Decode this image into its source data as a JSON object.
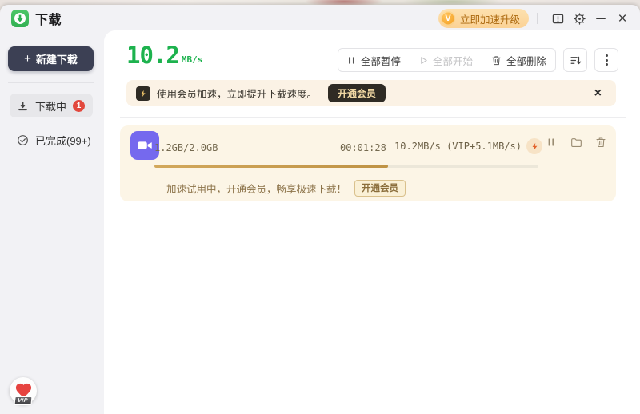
{
  "titlebar": {
    "app_title": "下载",
    "upgrade_button": {
      "badge_letter": "V",
      "label": "立即加速升级"
    }
  },
  "icons": {
    "plus": "+",
    "close": "×"
  },
  "sidebar": {
    "new_download_label": "新建下载",
    "items": [
      {
        "label": "下载中",
        "badge": "1"
      },
      {
        "label": "已完成(99+)"
      }
    ],
    "vip_tag": "VIP"
  },
  "header": {
    "speed_value": "10.2",
    "speed_unit": "MB/s",
    "toolbar": {
      "pause_all": "全部暂停",
      "start_all": "全部开始",
      "delete_all": "全部删除"
    }
  },
  "banner": {
    "message": "使用会员加速，立即提升下载速度。",
    "cta": "开通会员"
  },
  "task": {
    "size": "1.2GB/2.0GB",
    "time": "00:01:28",
    "speed": "10.2MB/s (VIP+5.1MB/s)",
    "progress_percent": 60.8,
    "trial_message": "加速试用中，开通会员，畅享极速下载！",
    "trial_cta": "开通会员"
  },
  "colors": {
    "window-bg": "#f2f2f5",
    "speed-green": "#1db24e",
    "gold": "#bf9345",
    "banner-bg": "#fbf2e5",
    "card-bg": "#fcf5e6",
    "badge-red": "#e2483d",
    "dark-button-bg": "#2f2b24",
    "dark-button-text": "#f2d9a4",
    "sidebar-button-bg": "#3c4054",
    "file-icon-purple": "#7569ee",
    "pill-bg": "#fbd295",
    "pill-text": "#ab680e",
    "trial-text": "#8c7349"
  }
}
